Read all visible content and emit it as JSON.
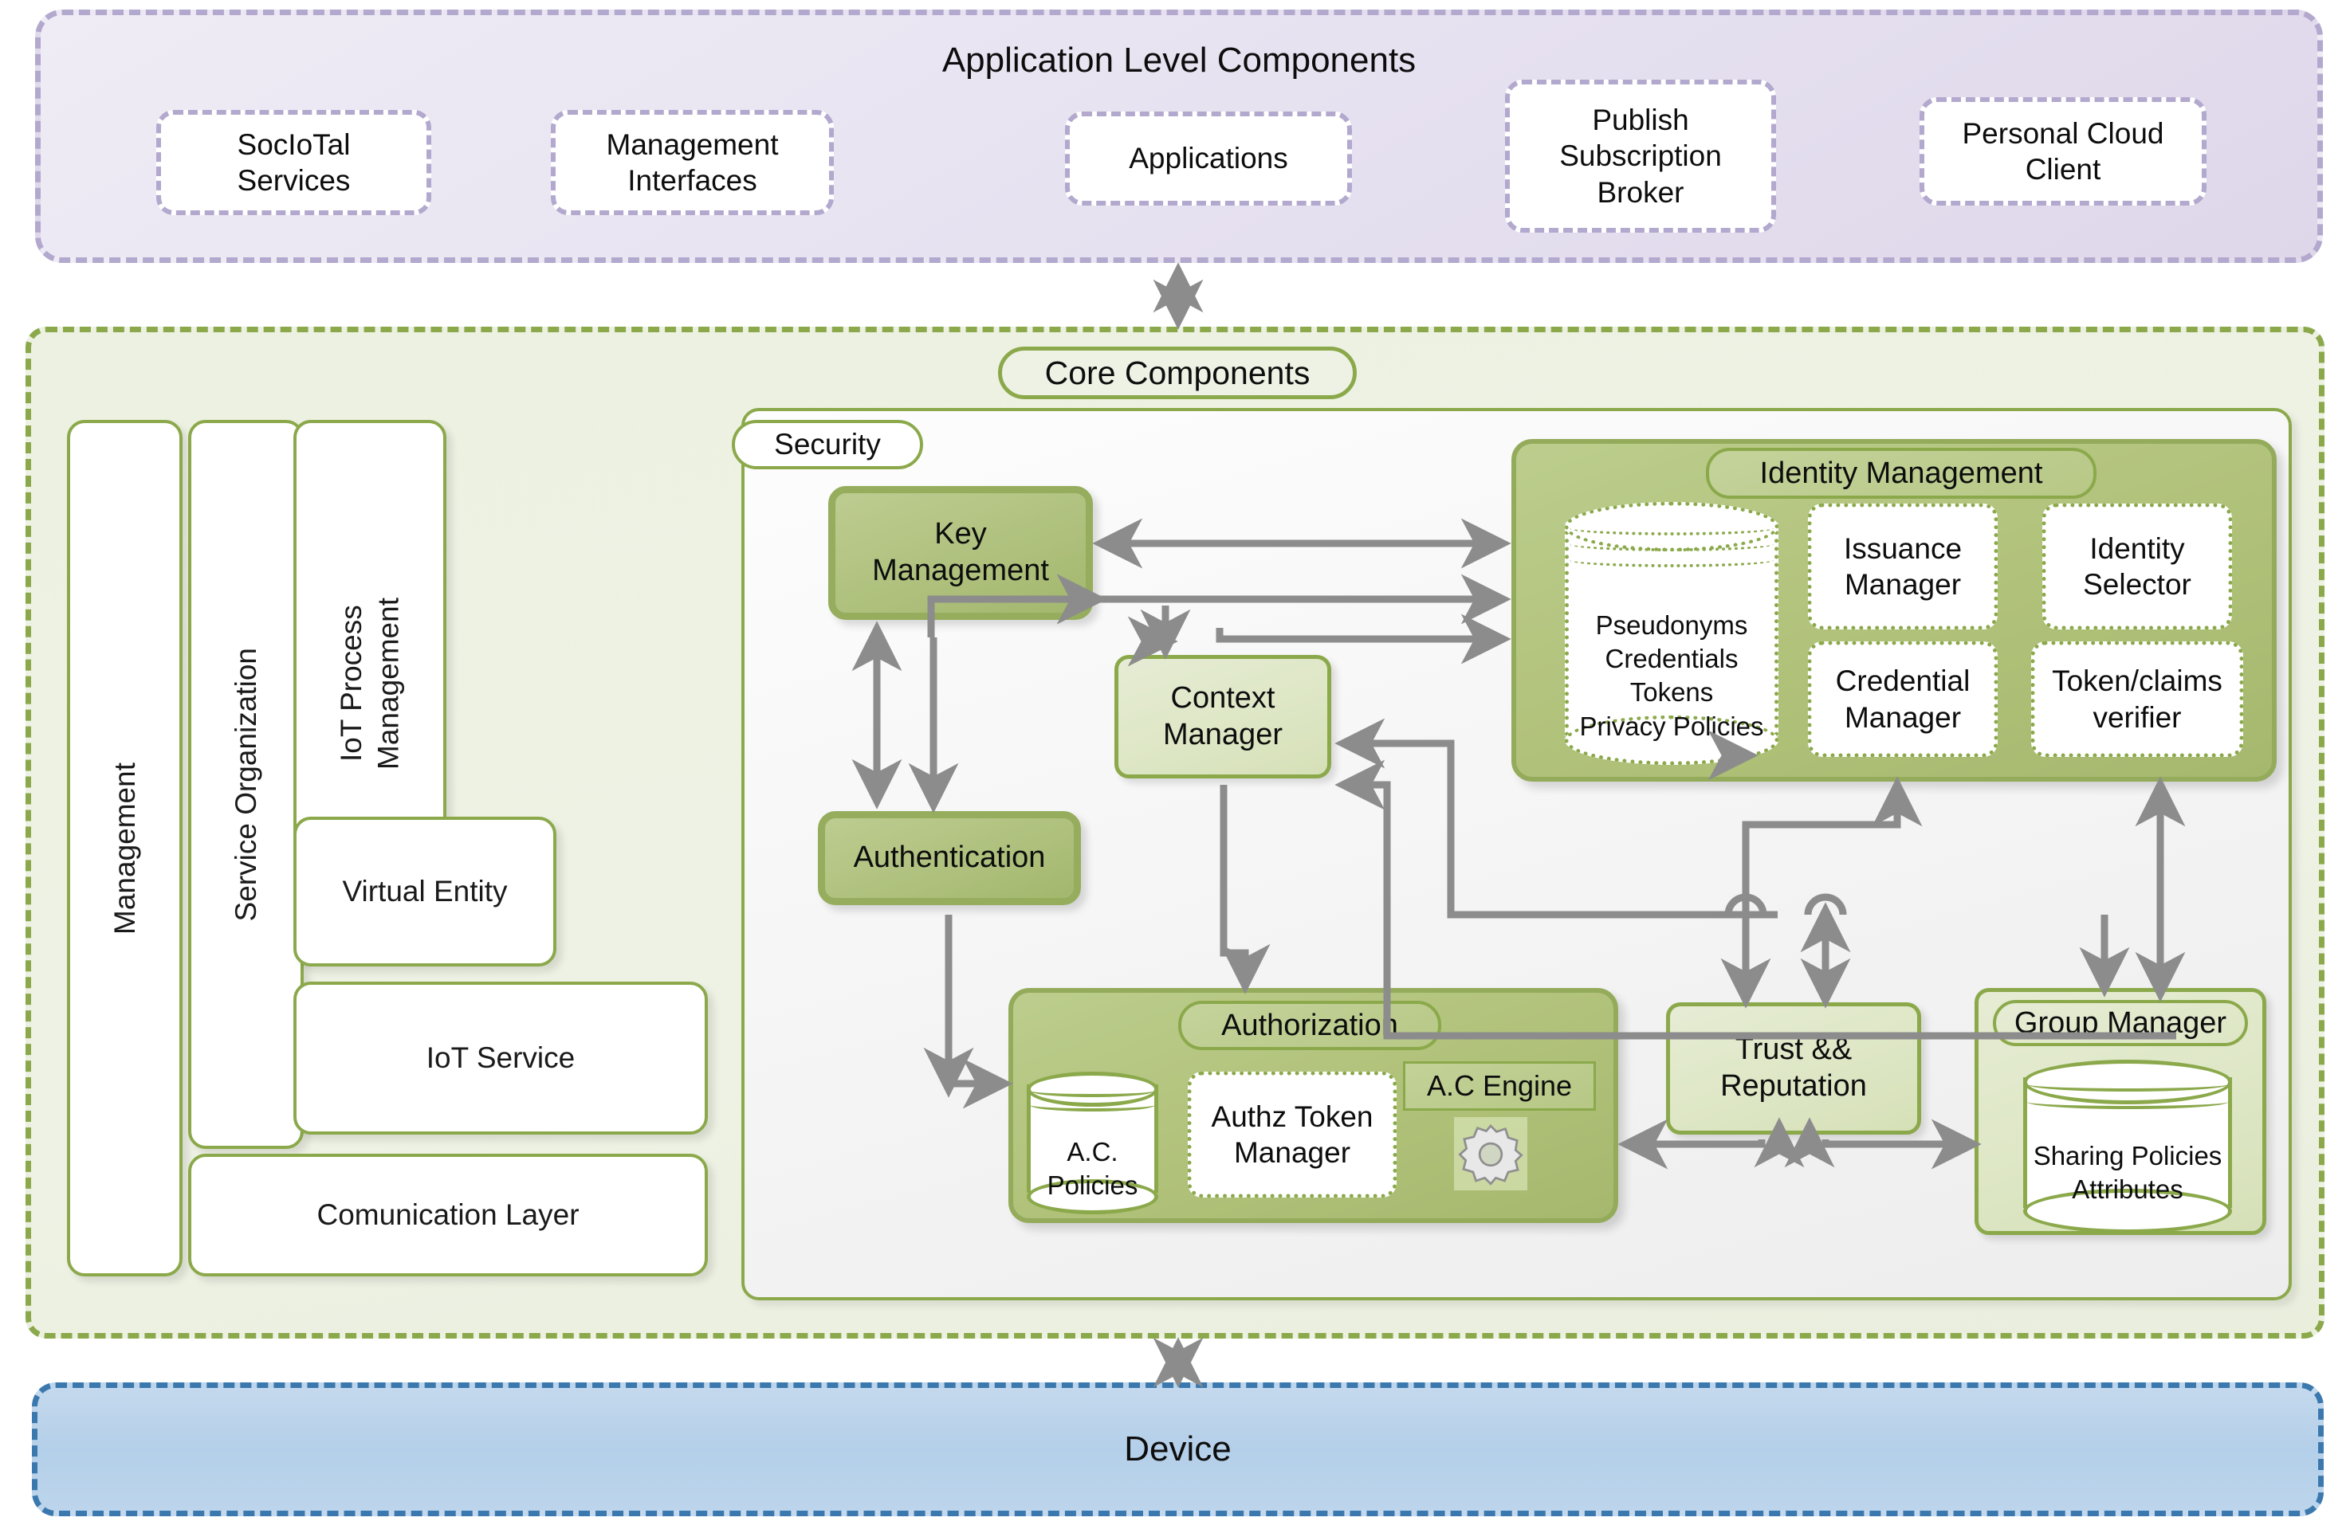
{
  "application_layer": {
    "title": "Application Level Components",
    "boxes": [
      {
        "label": "SocIoTal\nServices"
      },
      {
        "label": "Management\nInterfaces"
      },
      {
        "label": "Applications"
      },
      {
        "label": "Publish\nSubscription\nBroker"
      },
      {
        "label": "Personal Cloud\nClient"
      }
    ]
  },
  "core_layer": {
    "title": "Core Components",
    "left_stack": [
      {
        "label": "Management",
        "orientation": "vertical"
      },
      {
        "label": "Service Organization",
        "orientation": "vertical"
      },
      {
        "label": "IoT Process\nManagement",
        "orientation": "vertical"
      },
      {
        "label": "Virtual Entity",
        "orientation": "horizontal"
      },
      {
        "label": "IoT Service",
        "orientation": "horizontal"
      },
      {
        "label": "Comunication Layer",
        "orientation": "horizontal"
      }
    ],
    "security": {
      "title": "Security",
      "key_management": "Key\nManagement",
      "authentication": "Authentication",
      "context_manager": "Context\nManager",
      "identity_management": {
        "title": "Identity Management",
        "store": "Pseudonyms\nCredentials\nTokens\nPrivacy Policies",
        "store_lines": [
          "Pseudonyms",
          "Credentials",
          "Tokens",
          "Privacy Policies"
        ],
        "cards": [
          "Issuance\nManager",
          "Identity\nSelector",
          "Credential\nManager",
          "Token/claims\nverifier"
        ]
      },
      "authorization": {
        "title": "Authorization",
        "policies_store": "A.C.\nPolicies",
        "policies_store_lines": [
          "A.C.",
          "Policies"
        ],
        "token_manager": "Authz Token\nManager",
        "ac_engine": "A.C Engine",
        "ac_engine_icon": "gear-icon"
      },
      "trust_reputation": "Trust &&\nReputation",
      "group_manager": {
        "title": "Group Manager",
        "store": "Sharing Policies\nAttributes",
        "store_lines": [
          "Sharing Policies",
          "Attributes"
        ]
      }
    }
  },
  "device_layer": {
    "title": "Device"
  },
  "colors": {
    "application_border": "#b3a8cd",
    "application_fill": "#e9e4f1",
    "core_border": "#8ba94b",
    "core_fill": "#eef2e4",
    "component_dark": "#aec07c",
    "component_light": "#dde6c4",
    "group_fill": "#b0c179",
    "device_border": "#3b78ad",
    "device_fill": "#b4cfe9",
    "arrow": "#8c8c8c"
  }
}
